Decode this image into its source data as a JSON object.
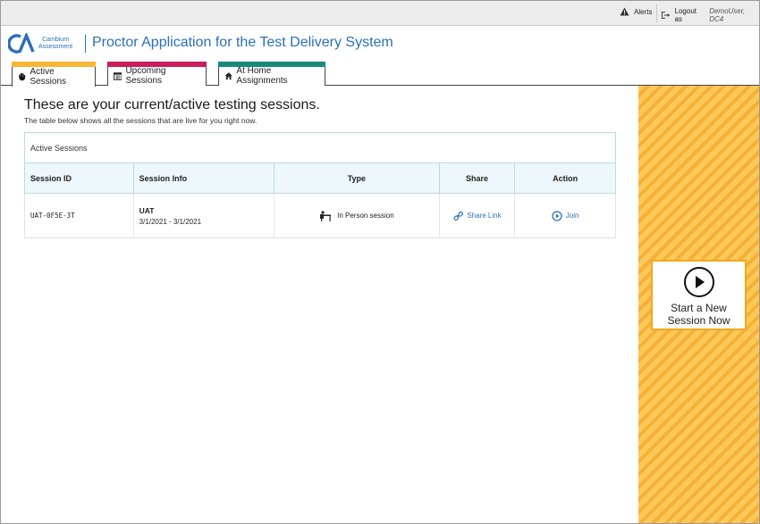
{
  "topbar": {
    "alerts_label": "Alerts",
    "logout_label": "Logout as",
    "user": "DemoUser, DC4"
  },
  "header": {
    "logo_line1": "Cambium",
    "logo_line2": "Assessment",
    "app_title": "Proctor Application for the Test Delivery System",
    "brand_color": "#2d6fb6"
  },
  "tabs": [
    {
      "label": "Active Sessions",
      "icon": "hand-icon",
      "color": "#f7b733",
      "active": true
    },
    {
      "label": "Upcoming Sessions",
      "icon": "calendar-icon",
      "color": "#c81d5e",
      "active": false
    },
    {
      "label": "At Home Assignments",
      "icon": "home-icon",
      "color": "#178a7c",
      "active": false
    }
  ],
  "main": {
    "heading": "These are your current/active testing sessions.",
    "subheading": "The table below shows all the sessions that are live for you right now.",
    "panel_title": "Active Sessions",
    "columns": [
      "Session ID",
      "Session Info",
      "Type",
      "Share",
      "Action"
    ],
    "rows": [
      {
        "session_id": "UAT-0F5E-3T",
        "info_name": "UAT",
        "info_dates": "3/1/2021 - 3/1/2021",
        "type": "In Person session",
        "type_icon": "desk-icon",
        "share": "Share Link",
        "share_icon": "link-icon",
        "action": "Join",
        "action_icon": "play-circle-icon"
      }
    ]
  },
  "sidebar": {
    "new_session_label": "Start a New\nSession Now",
    "accent": "#f7b037"
  }
}
